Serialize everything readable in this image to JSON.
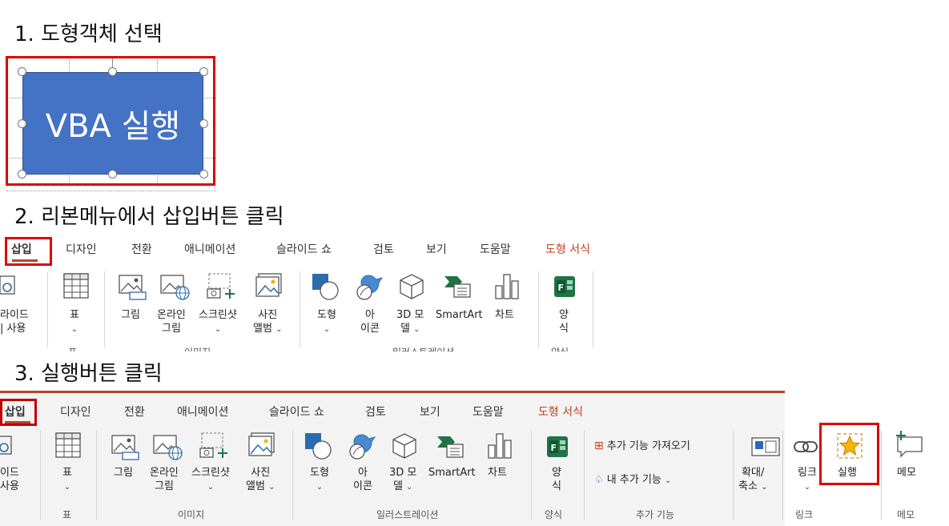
{
  "steps": {
    "s1": "1. 도형객체 선택",
    "s2": "2. 리본메뉴에서 삽입버튼 클릭",
    "s3": "3. 실행버튼 클릭"
  },
  "shape": {
    "text": "VBA 실행",
    "fill": "#4472c4"
  },
  "ribbon1": {
    "tabs": [
      "삽입",
      "디자인",
      "전환",
      "애니메이션",
      "슬라이드 쇼",
      "검토",
      "보기",
      "도움말",
      "도형 서식"
    ],
    "partial_left": [
      "라이드",
      "| 사용"
    ],
    "buttons": {
      "table": "표",
      "picture": "그림",
      "online_picture": [
        "온라인",
        "그림"
      ],
      "screenshot": "스크린샷",
      "album": [
        "사진",
        "앨범"
      ],
      "shapes": "도형",
      "icons": [
        "아",
        "이콘"
      ],
      "model3d": [
        "3D 모",
        "델"
      ],
      "smartart": "SmartArt",
      "chart": "차트",
      "form": [
        "양",
        "식"
      ]
    },
    "groups_partial": [
      "표",
      "이미지",
      "일러스트레이션",
      "양식"
    ]
  },
  "ribbon2": {
    "tabs": [
      "삽입",
      "디자인",
      "전환",
      "애니메이션",
      "슬라이드 쇼",
      "검토",
      "보기",
      "도움말",
      "도형 서식"
    ],
    "partial_left": [
      "이드",
      "사용"
    ],
    "buttons": {
      "table": "표",
      "picture": "그림",
      "online_picture": [
        "온라인",
        "그림"
      ],
      "screenshot": "스크린샷",
      "album": [
        "사진",
        "앨범"
      ],
      "shapes": "도형",
      "icons": [
        "아",
        "이콘"
      ],
      "model3d": [
        "3D 모",
        "델"
      ],
      "smartart": "SmartArt",
      "chart": "차트",
      "form": [
        "양",
        "식"
      ],
      "get_addins": "추가 기능 가져오기",
      "my_addins": "내 추가 기능",
      "zoom": [
        "확대/",
        "축소"
      ],
      "link": "링크",
      "action": "실행",
      "comment": "메모"
    },
    "groups": [
      "표",
      "이미지",
      "일러스트레이션",
      "양식",
      "추가 기능",
      "링크",
      "메모"
    ]
  },
  "colors": {
    "accent": "#b5452a",
    "highlight": "#e00000",
    "icon_blue": "#2b6cb0",
    "icon_green": "#217346",
    "star": "#f5b400"
  }
}
